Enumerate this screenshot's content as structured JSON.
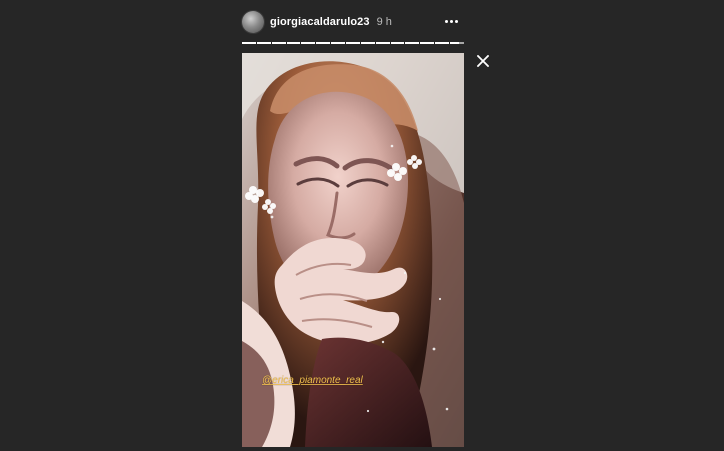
{
  "header": {
    "username": "giorgiacaldarulo23",
    "time": "9 h",
    "avatar_icon": "profile-avatar"
  },
  "story": {
    "mention": "@erica_piamonte_real",
    "segment_count": 15,
    "current_segment_progress": 0.62,
    "progress_color": "#ffffff",
    "mention_color": "#f2c14e"
  },
  "controls": {
    "more_icon": "ellipsis-icon",
    "close_icon": "close-icon"
  }
}
